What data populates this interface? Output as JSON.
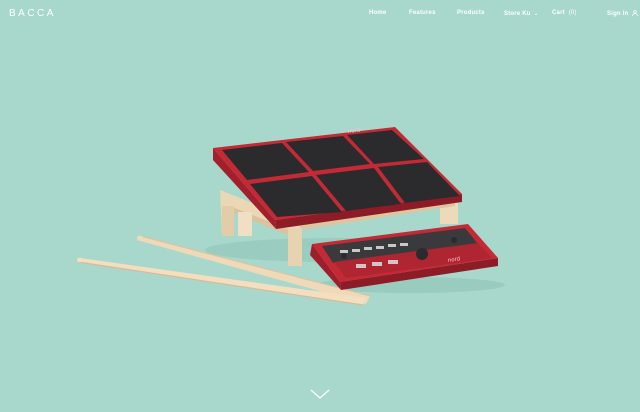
{
  "brand": {
    "name": "BACCA"
  },
  "nav": {
    "items": [
      {
        "label": "Home",
        "dropdown": false
      },
      {
        "label": "Features",
        "dropdown": false
      },
      {
        "label": "Products",
        "dropdown": false
      },
      {
        "label": "Store Ku",
        "dropdown": true
      }
    ],
    "cart": {
      "label": "Cart",
      "count": "0"
    },
    "signin": {
      "label": "Sign In"
    }
  },
  "colors": {
    "background": "#a7d8cb",
    "accent_red": "#c42a36",
    "pad_black": "#2b2b2d",
    "wood": "#ead7b6",
    "nav_text": "#ffffff"
  },
  "hero": {
    "product_brand_mark": "nord"
  },
  "icons": {
    "user": "user-icon",
    "scroll_down": "chevron-down-icon"
  }
}
